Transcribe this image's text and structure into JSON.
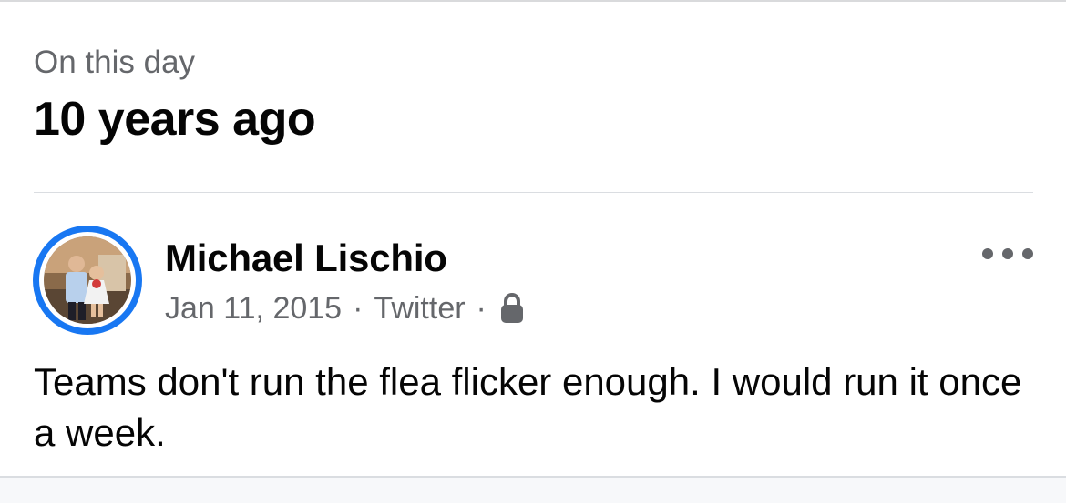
{
  "header": {
    "eyebrow": "On this day",
    "title": "10 years ago"
  },
  "post": {
    "author": "Michael Lischio",
    "date": "Jan 11, 2015",
    "separator": "·",
    "source": "Twitter",
    "privacy_icon": "lock-icon",
    "more_icon": "more-horizontal-icon",
    "text": "Teams don't run the flea flicker enough. I would run it once a week."
  },
  "colors": {
    "accent": "#1877f2",
    "text_primary": "#050505",
    "text_secondary": "#65676b",
    "divider": "#dadde1"
  }
}
